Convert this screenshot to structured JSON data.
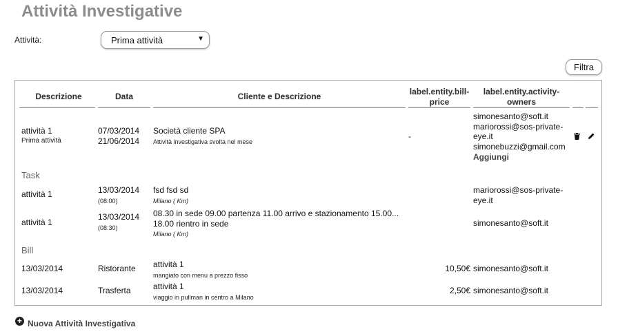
{
  "page": {
    "title": "Attività Investigative"
  },
  "filter": {
    "label": "Attività:",
    "selected": "Prima attività",
    "button": "Filtra"
  },
  "table": {
    "headers": {
      "descrizione": "Descrizione",
      "data": "Data",
      "cliente": "Cliente e Descrizione",
      "price_line1": "label.entity.bill-",
      "price_line2": "price",
      "owners_line1": "label.entity.activity-",
      "owners_line2": "owners"
    },
    "activity": {
      "name": "attività 1",
      "sub": "Prima attività",
      "date_start": "07/03/2014",
      "date_end": "21/06/2014",
      "client": "Società cliente SPA",
      "client_desc": "Attività investigativa svolta nel mese",
      "price": "-",
      "owners": [
        "simonesanto@soft.it",
        "mariorossi@sos-private-",
        "eye.it",
        "simonebuzzi@gmail.com"
      ],
      "owners_add": "Aggiungi"
    },
    "task_section": "Task",
    "tasks": [
      {
        "name": "attività 1",
        "date": "13/03/2014",
        "time": "(08:00)",
        "desc": "fsd fsd sd",
        "place": "Milano ( Km)",
        "owner1": "mariorossi@sos-private-",
        "owner2": "eye.it"
      },
      {
        "name": "attività 1",
        "date": "13/03/2014",
        "time": "(08:30)",
        "desc1": "08.30 in sede 09.00 partenza 11.00 arrivo e stazionamento 15.00...",
        "desc2": "18.00 rientro in sede",
        "place": "Milano ( Km)",
        "owner": "simonesanto@soft.it"
      }
    ],
    "bill_section": "Bill",
    "bills": [
      {
        "date": "13/03/2014",
        "type": "Ristorante",
        "act": "attività 1",
        "desc": "mangiato con menu a prezzo fisso",
        "price": "10,50€",
        "owner": "simonesanto@soft.it"
      },
      {
        "date": "13/03/2014",
        "type": "Trasferta",
        "act": "attività 1",
        "desc": "viaggio in pullman in centro a Milano",
        "price": "2,50€",
        "owner": "simonesanto@soft.it"
      }
    ]
  },
  "footer": {
    "add_label": "Nuova Attività Investigativa"
  }
}
